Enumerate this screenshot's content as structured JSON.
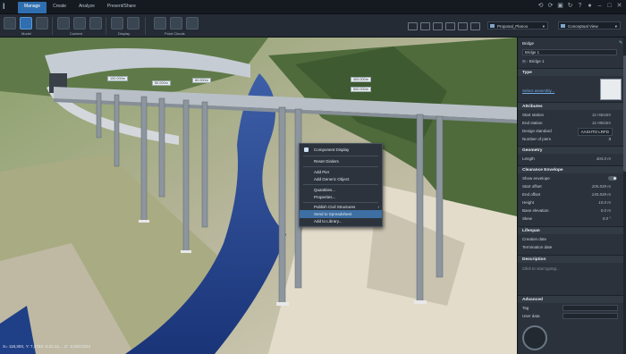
{
  "window": {
    "tabs": [
      "Manage",
      "Create",
      "Analyze",
      "Present/Share"
    ],
    "active_tab": "Manage"
  },
  "toolbar": {
    "groups": [
      "Model",
      "Content",
      "Display",
      "Point Clouds"
    ],
    "proposal": "Proposal_Planoo",
    "view": "Conceptual View"
  },
  "context_menu": {
    "items": [
      {
        "label": "Component Display",
        "checked": true
      },
      {
        "label": "Reset Girders"
      },
      {
        "label": "Add Pier"
      },
      {
        "label": "Add Generic Object"
      },
      {
        "label": "Quantities..."
      },
      {
        "label": "Properties..."
      },
      {
        "label": "Publish Civil Structures",
        "submenu": true
      },
      {
        "label": "Send to Spreadsheet",
        "highlighted": true
      },
      {
        "label": "Add to Library..."
      }
    ]
  },
  "viewport": {
    "labels": [
      "100.000m",
      "80.000m",
      "60.000m",
      "400.000m",
      "500.000m"
    ],
    "coordinates": "X= 118,30X, Y: 7,372X: 0.21.12,... Z: -2,0/2C/Z24"
  },
  "panel": {
    "title": "Bridge",
    "name": "Bridge 1",
    "breadcrumb": "Bridge 1",
    "sections": {
      "type": {
        "header": "Type",
        "link": "Select assembly..."
      },
      "attributes": {
        "header": "Attributes",
        "rows": [
          {
            "label": "Start station",
            "value": "11+5610m"
          },
          {
            "label": "End station",
            "value": "11+9810m"
          },
          {
            "label": "Design standard",
            "value": "AASHTO LRFD"
          },
          {
            "label": "Number of piers",
            "value": "3"
          }
        ]
      },
      "geometry": {
        "header": "Geometry",
        "rows": [
          {
            "label": "Length",
            "value": "404.0 m"
          }
        ]
      },
      "clearance": {
        "header": "Clearance Envelope",
        "rows": [
          {
            "label": "Show envelope",
            "value": ""
          },
          {
            "label": "Start offset",
            "value": "205.839 m"
          },
          {
            "label": "End offset",
            "value": "245.839 m"
          },
          {
            "label": "Height",
            "value": "10.0 m"
          },
          {
            "label": "Base elevation",
            "value": "0.0 m"
          },
          {
            "label": "Skew",
            "value": "0.0 °"
          }
        ]
      },
      "lifespan": {
        "header": "Lifespan",
        "rows": [
          {
            "label": "Creation date"
          },
          {
            "label": "Termination date"
          }
        ]
      },
      "description": {
        "header": "Description",
        "placeholder": "Click to start typing..."
      },
      "advanced": {
        "header": "Advanced",
        "rows": [
          {
            "label": "Tag"
          },
          {
            "label": "User data"
          }
        ]
      }
    }
  },
  "colors": {
    "accent": "#2f6fb0",
    "panel_bg": "#2b323b",
    "water": "#1f3f86",
    "deck": "#bfc5cc"
  }
}
